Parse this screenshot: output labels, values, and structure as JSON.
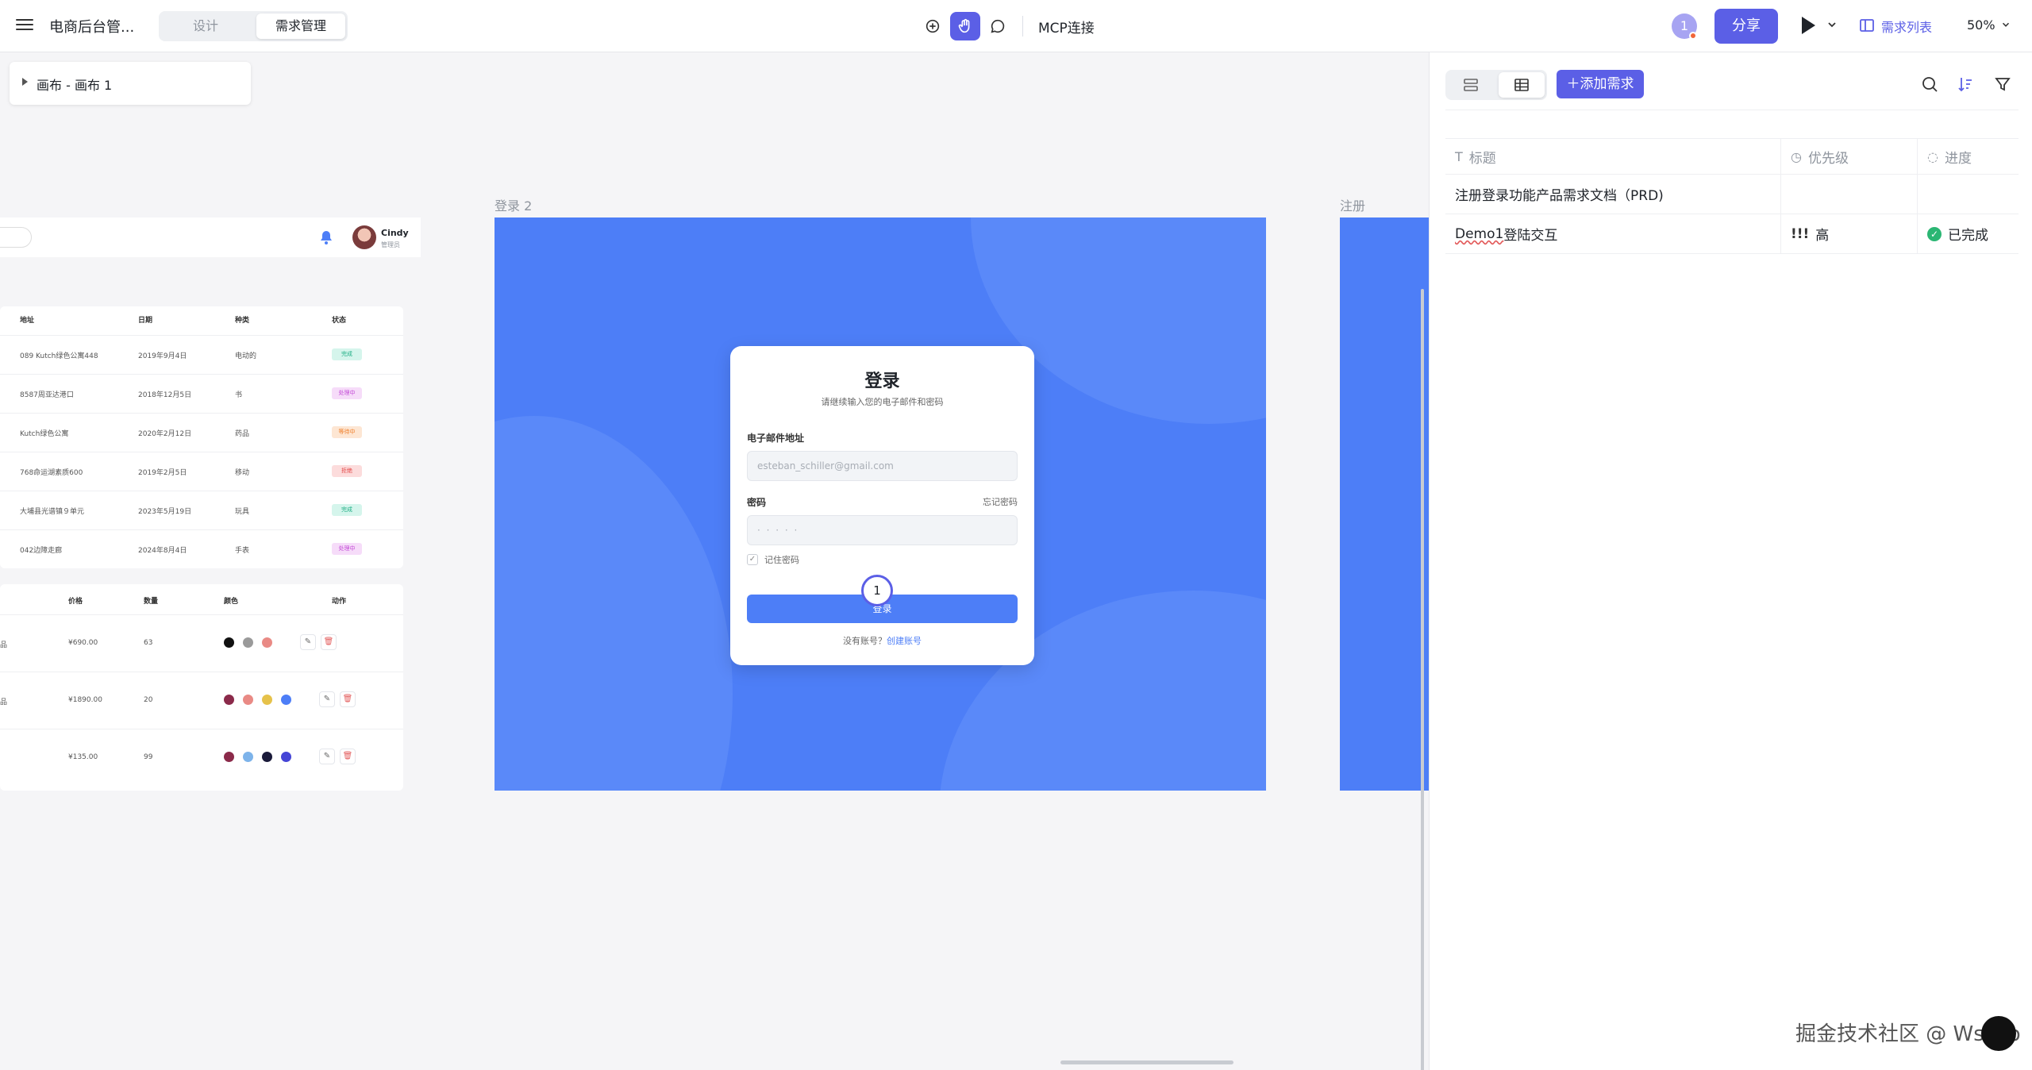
{
  "topbar": {
    "app_title": "电商后台管...",
    "tabs": [
      "设计",
      "需求管理"
    ],
    "mcp_label": "MCP连接",
    "avatar_count": "1",
    "share_label": "分享",
    "req_list_label": "需求列表",
    "zoom": "50%"
  },
  "layers": {
    "item": "画布 - 画布 1"
  },
  "dashboard": {
    "user_name": "Cindy",
    "user_role": "管理员",
    "table1": {
      "headers": [
        "地址",
        "日期",
        "种类",
        "状态"
      ],
      "rows": [
        {
          "address": "089 Kutch绿色公寓448",
          "date": "2019年9月4日",
          "type": "电动的",
          "status": "完成"
        },
        {
          "address": "8587周亚达港口",
          "date": "2018年12月5日",
          "type": "书",
          "status": "处理中"
        },
        {
          "address": "Kutch绿色公寓",
          "date": "2020年2月12日",
          "type": "药品",
          "status": "等待中"
        },
        {
          "address": "768命运湖素质600",
          "date": "2019年2月5日",
          "type": "移动",
          "status": "拒绝"
        },
        {
          "address": "大埔县光谱镇９单元",
          "date": "2023年5月19日",
          "type": "玩具",
          "status": "完成"
        },
        {
          "address": "042边障走廊",
          "date": "2024年8月4日",
          "type": "手表",
          "status": "处理中"
        }
      ]
    },
    "table2": {
      "headers": [
        "价格",
        "数量",
        "颜色",
        "动作"
      ],
      "rows": [
        {
          "name": "品",
          "price": "¥690.00",
          "qty": "63"
        },
        {
          "name": "品",
          "price": "¥1890.00",
          "qty": "20"
        },
        {
          "name": "",
          "price": "¥135.00",
          "qty": "99"
        }
      ]
    },
    "colors": {
      "done_bg": "#d5f5ec",
      "done_fg": "#1fae85",
      "processing_bg": "#f6dcf9",
      "processing_fg": "#c34bd6",
      "waiting_bg": "#fde6d3",
      "waiting_fg": "#f0822f",
      "reject_bg": "#fcdcdc",
      "reject_fg": "#e34848"
    }
  },
  "frames": {
    "login_label": "登录 2",
    "register_label": "注册"
  },
  "login": {
    "title": "登录",
    "subtitle": "请继续输入您的电子邮件和密码",
    "email_label": "电子邮件地址",
    "email_value": "esteban_schiller@gmail.com",
    "password_label": "密码",
    "forgot": "忘记密码",
    "password_value": "· · · · ·",
    "remember": "记住密码",
    "button": "登录",
    "no_account": "没有账号？",
    "create_account": "创建账号",
    "step_marker": "1"
  },
  "requirements": {
    "add_label": "添加需求",
    "columns": [
      "标题",
      "优先级",
      "进度"
    ],
    "rows": [
      {
        "title": "注册登录功能产品需求文档（PRD)",
        "priority": "",
        "progress": ""
      },
      {
        "title": "Demo1登陆交互",
        "title_underlined": "Demo1",
        "title_rest": "登陆交互",
        "priority_mark": "!!!",
        "priority": "高",
        "progress": "已完成"
      }
    ],
    "accent": "#5b5fe6"
  },
  "watermark": "掘金技术社区 @ WsLeo"
}
